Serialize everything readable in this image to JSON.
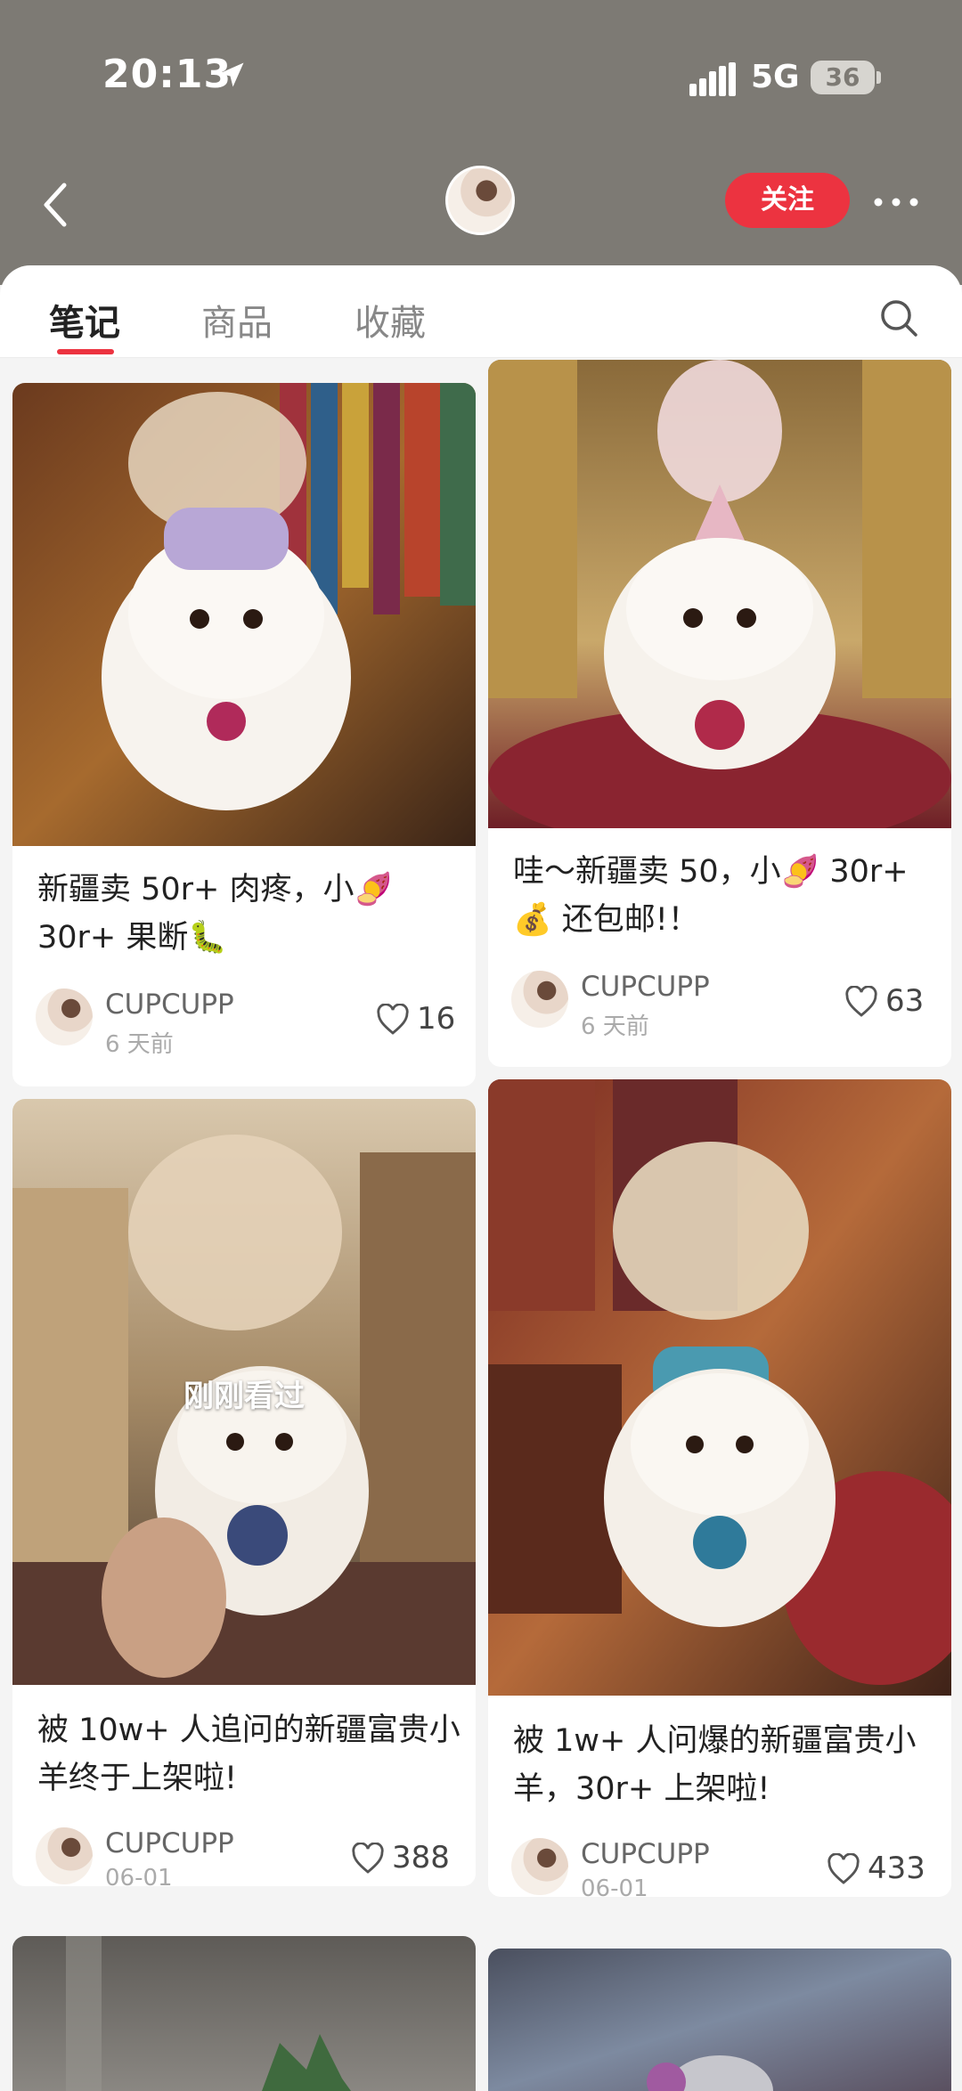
{
  "status": {
    "time": "20:13",
    "network": "5G",
    "battery": "36"
  },
  "header": {
    "follow_label": "关注"
  },
  "tabs": [
    {
      "label": "笔记",
      "active": true
    },
    {
      "label": "商品",
      "active": false
    },
    {
      "label": "收藏",
      "active": false
    }
  ],
  "colors": {
    "accent": "#ec3340",
    "header_bg": "#7d7a74"
  },
  "cards": [
    {
      "title": "新疆卖 50r+ 肉疼，小🍠 30r+ 果断🐛",
      "author": "CUPCUPP",
      "date": "6 天前",
      "likes": "16",
      "badge": ""
    },
    {
      "title": "哇～新疆卖 50，小🍠 30r+ 💰 还包邮!！",
      "author": "CUPCUPP",
      "date": "6 天前",
      "likes": "63",
      "badge": ""
    },
    {
      "title": "被 10w+ 人追问的新疆富贵小羊终于上架啦!",
      "author": "CUPCUPP",
      "date": "06-01",
      "likes": "388",
      "badge": "刚刚看过"
    },
    {
      "title": "被 1w+ 人问爆的新疆富贵小羊，30r+ 上架啦!",
      "author": "CUPCUPP",
      "date": "06-01",
      "likes": "433",
      "badge": ""
    }
  ]
}
